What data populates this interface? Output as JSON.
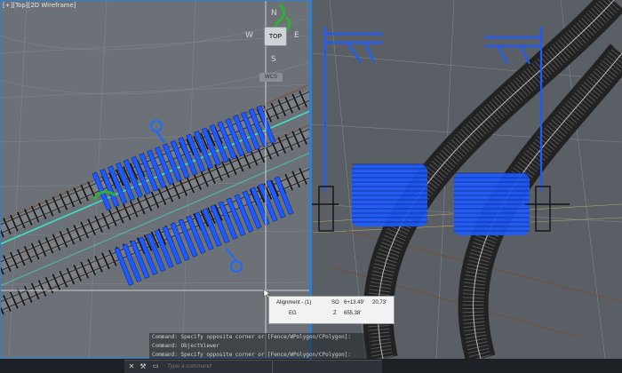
{
  "viewport_left": {
    "label": "[+][Top][2D Wireframe]",
    "viewcube": {
      "north": "N",
      "south": "S",
      "east": "E",
      "west": "W",
      "top_face": "TOP",
      "wcs": "WCS"
    }
  },
  "tooltip": {
    "row1_label": "Alignment - (1)",
    "row1_key": "SO",
    "row1_value": "6+13.49'",
    "row1_extra": "20.73'",
    "row2_label": "EG",
    "row2_key": "Z",
    "row2_value": "655.38'"
  },
  "command_history": [
    "Command: Specify opposite corner or [Fence/WPolygon/CPolygon]:",
    "Command: ObjectViewer",
    "Command: Specify opposite corner or [Fence/WPolygon/CPolygon]:"
  ],
  "command_line": {
    "placeholder": "Type a command"
  },
  "icons": {
    "close": "close-icon",
    "customize": "wrench-icon",
    "prompt": "command-prompt-icon"
  },
  "colors": {
    "selection": "#1e5bff",
    "viewport_border": "#2b7fd6",
    "alignment": "#3ee0c8",
    "grip": "#1a6bff"
  }
}
